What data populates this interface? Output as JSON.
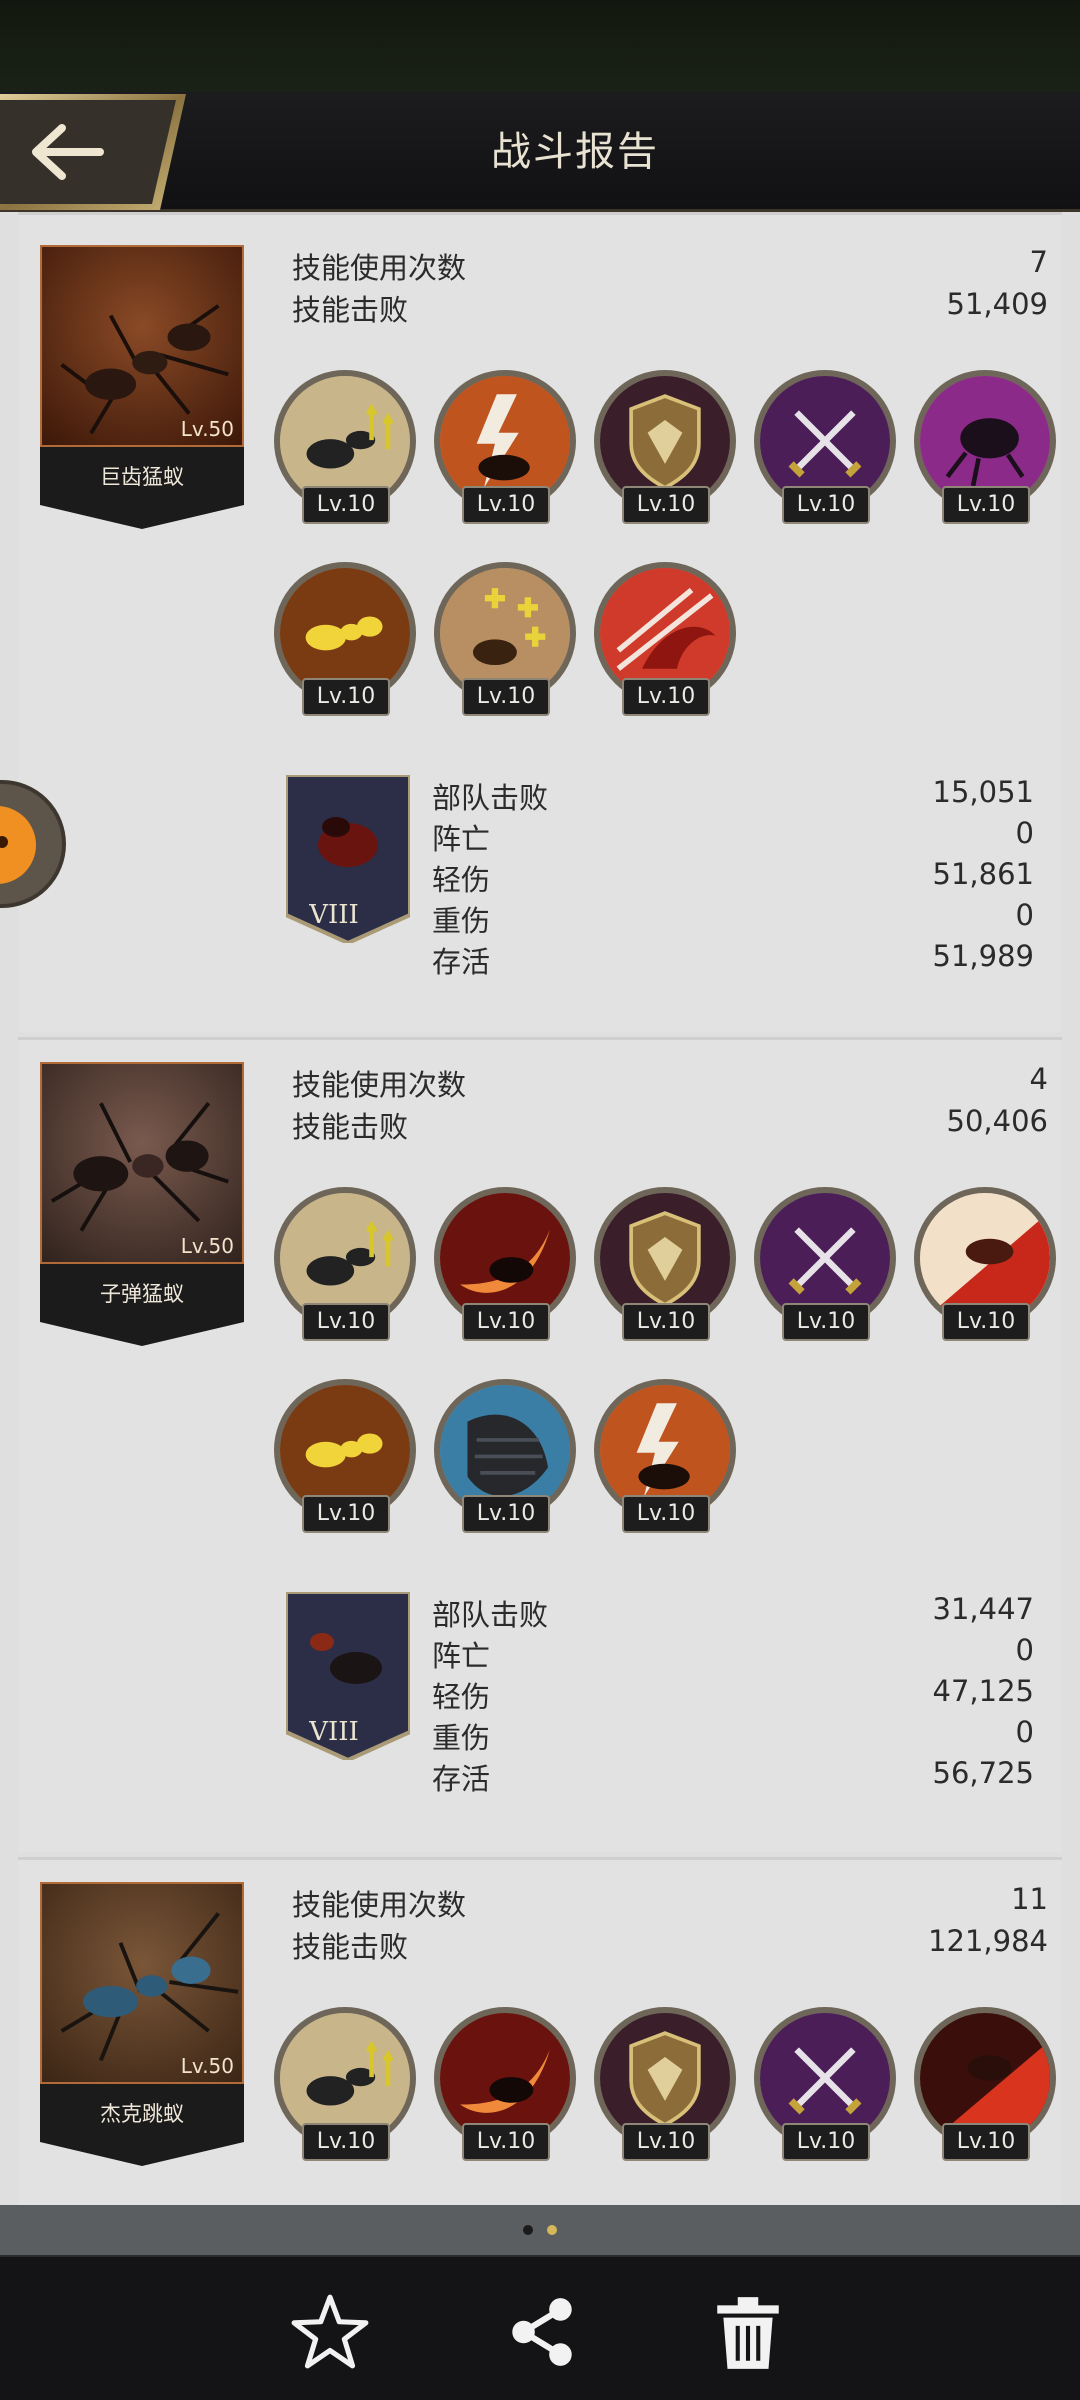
{
  "header": {
    "title": "战斗报告",
    "back_icon": "arrow-left-icon"
  },
  "units": [
    {
      "name": "巨齿猛蚁",
      "level": "Lv.50",
      "skill_uses_label": "技能使用次数",
      "skill_uses_value": "7",
      "skill_kills_label": "技能击败",
      "skill_kills_value": "51,409",
      "skills": [
        {
          "icon": "ants-buff-icon",
          "level": "Lv.10"
        },
        {
          "icon": "ant-lightning-icon",
          "level": "Lv.10"
        },
        {
          "icon": "shield-icon",
          "level": "Lv.10"
        },
        {
          "icon": "crossed-swords-icon",
          "level": "Lv.10"
        },
        {
          "icon": "beetle-claw-icon",
          "level": "Lv.10"
        },
        {
          "icon": "golden-ant-icon",
          "level": "Lv.10"
        },
        {
          "icon": "ant-plus-icon",
          "level": "Lv.10"
        },
        {
          "icon": "red-jaw-icon",
          "level": "Lv.10"
        }
      ],
      "troop_badge": "VIII",
      "troop_stats": [
        {
          "label": "部队击败",
          "value": "15,051"
        },
        {
          "label": "阵亡",
          "value": "0"
        },
        {
          "label": "轻伤",
          "value": "51,861"
        },
        {
          "label": "重伤",
          "value": "0"
        },
        {
          "label": "存活",
          "value": "51,989"
        }
      ]
    },
    {
      "name": "子弹猛蚁",
      "level": "Lv.50",
      "skill_uses_label": "技能使用次数",
      "skill_uses_value": "4",
      "skill_kills_label": "技能击败",
      "skill_kills_value": "50,406",
      "skills": [
        {
          "icon": "ants-buff-icon",
          "level": "Lv.10"
        },
        {
          "icon": "ant-slash-icon",
          "level": "Lv.10"
        },
        {
          "icon": "shield-icon",
          "level": "Lv.10"
        },
        {
          "icon": "crossed-swords-icon",
          "level": "Lv.10"
        },
        {
          "icon": "ant-charge-icon",
          "level": "Lv.10"
        },
        {
          "icon": "golden-ant-icon",
          "level": "Lv.10"
        },
        {
          "icon": "armor-scale-icon",
          "level": "Lv.10"
        },
        {
          "icon": "ant-lightning-icon",
          "level": "Lv.10"
        }
      ],
      "troop_badge": "VIII",
      "troop_stats": [
        {
          "label": "部队击败",
          "value": "31,447"
        },
        {
          "label": "阵亡",
          "value": "0"
        },
        {
          "label": "轻伤",
          "value": "47,125"
        },
        {
          "label": "重伤",
          "value": "0"
        },
        {
          "label": "存活",
          "value": "56,725"
        }
      ]
    },
    {
      "name": "杰克跳蚁",
      "level": "Lv.50",
      "skill_uses_label": "技能使用次数",
      "skill_uses_value": "11",
      "skill_kills_label": "技能击败",
      "skill_kills_value": "121,984",
      "skills": [
        {
          "icon": "ants-buff-icon",
          "level": "Lv.10"
        },
        {
          "icon": "ant-slash-icon",
          "level": "Lv.10"
        },
        {
          "icon": "shield-icon",
          "level": "Lv.10"
        },
        {
          "icon": "crossed-swords-icon",
          "level": "Lv.10"
        },
        {
          "icon": "ant-charge-icon",
          "level": "Lv.10"
        }
      ]
    }
  ],
  "pager": {
    "pages": 2,
    "current": 2,
    "active_color": "#d4b85a",
    "inactive_color": "#1a1a1a"
  },
  "toolbar": {
    "favorite_icon": "star-icon",
    "share_icon": "share-icon",
    "delete_icon": "trash-icon"
  },
  "colors": {
    "header_bg": "#151517",
    "content_bg": "#dfdfdf",
    "portrait_border": "#b26b38",
    "toolbar_bg": "#141416"
  }
}
